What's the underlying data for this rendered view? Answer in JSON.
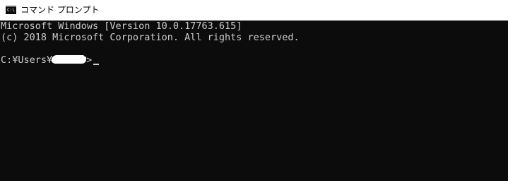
{
  "window": {
    "title": "コマンド プロンプト",
    "icon": "console-icon"
  },
  "console": {
    "lines": [
      "Microsoft Windows [Version 10.0.17763.615]",
      "(c) 2018 Microsoft Corporation. All rights reserved."
    ],
    "prompt_prefix": "C:¥Users¥",
    "prompt_suffix": ">"
  },
  "colors": {
    "background": "#0c0c0c",
    "text": "#cccccc",
    "titlebar": "#ffffff"
  }
}
